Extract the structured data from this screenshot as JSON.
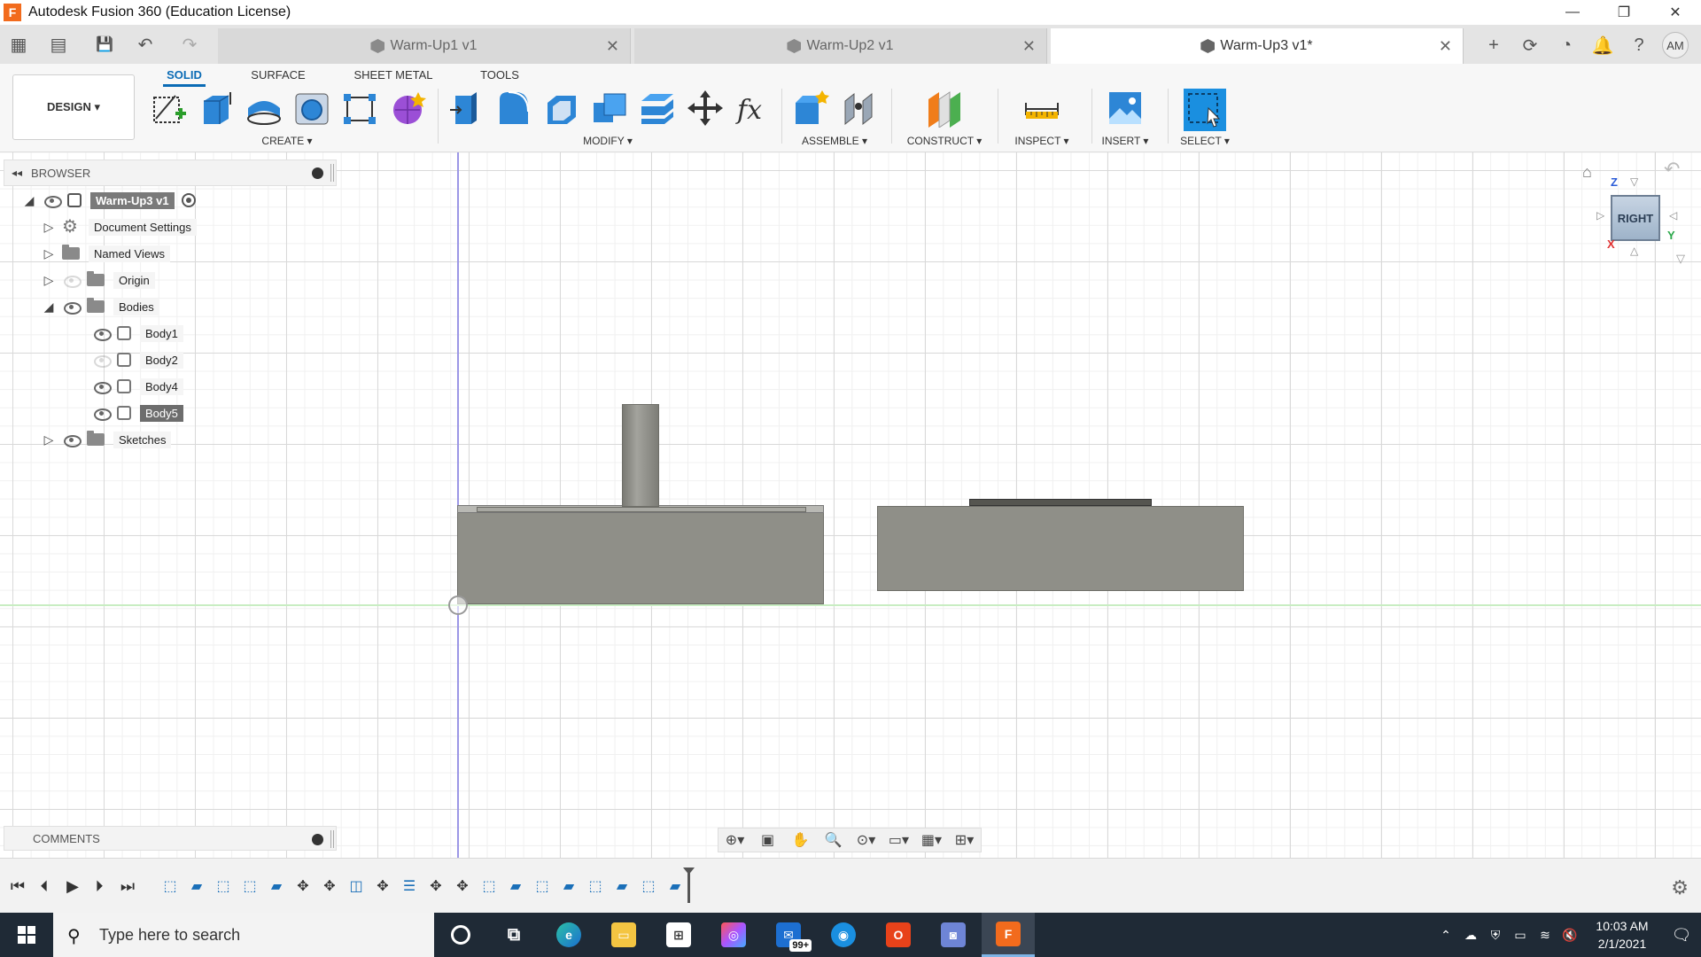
{
  "window": {
    "title": "Autodesk Fusion 360 (Education License)",
    "logo_letter": "F",
    "minimize": "—",
    "restore": "❐",
    "close": "✕"
  },
  "quick_access": {
    "grid_icon": "▦",
    "file_icon": "▤",
    "save_icon": "💾",
    "undo_icon": "↶",
    "redo_icon": "↷"
  },
  "tabs": [
    {
      "label": "Warm-Up1 v1",
      "active": false
    },
    {
      "label": "Warm-Up2 v1",
      "active": false
    },
    {
      "label": "Warm-Up3 v1*",
      "active": true
    }
  ],
  "tab_close": "✕",
  "header_right": {
    "new_tab": "+",
    "avatar": "AM"
  },
  "ribbon": {
    "workspace": "DESIGN ▾",
    "tabs": [
      "SOLID",
      "SURFACE",
      "SHEET METAL",
      "TOOLS"
    ],
    "groups": [
      "CREATE ▾",
      "MODIFY ▾",
      "ASSEMBLE ▾",
      "CONSTRUCT ▾",
      "INSPECT ▾",
      "INSERT ▾",
      "SELECT ▾"
    ]
  },
  "browser": {
    "title": "BROWSER",
    "root": "Warm-Up3 v1",
    "items": [
      {
        "label": "Document Settings"
      },
      {
        "label": "Named Views"
      },
      {
        "label": "Origin"
      },
      {
        "label": "Bodies"
      },
      {
        "label": "Body1"
      },
      {
        "label": "Body2"
      },
      {
        "label": "Body4"
      },
      {
        "label": "Body5"
      },
      {
        "label": "Sketches"
      }
    ]
  },
  "viewcube": {
    "face": "RIGHT",
    "z": "Z",
    "y": "Y",
    "x": "X"
  },
  "comments": {
    "title": "COMMENTS"
  },
  "taskbar": {
    "search_placeholder": "Type here to search",
    "mail_badge": "99+",
    "time": "10:03 AM",
    "date": "2/1/2021"
  },
  "colors": {
    "accent": "#0a6bb5",
    "body_fill": "#8f8f88",
    "axis_blue": "#9c97e6",
    "axis_green": "#c8edc2",
    "taskbar": "#1f2a36"
  }
}
